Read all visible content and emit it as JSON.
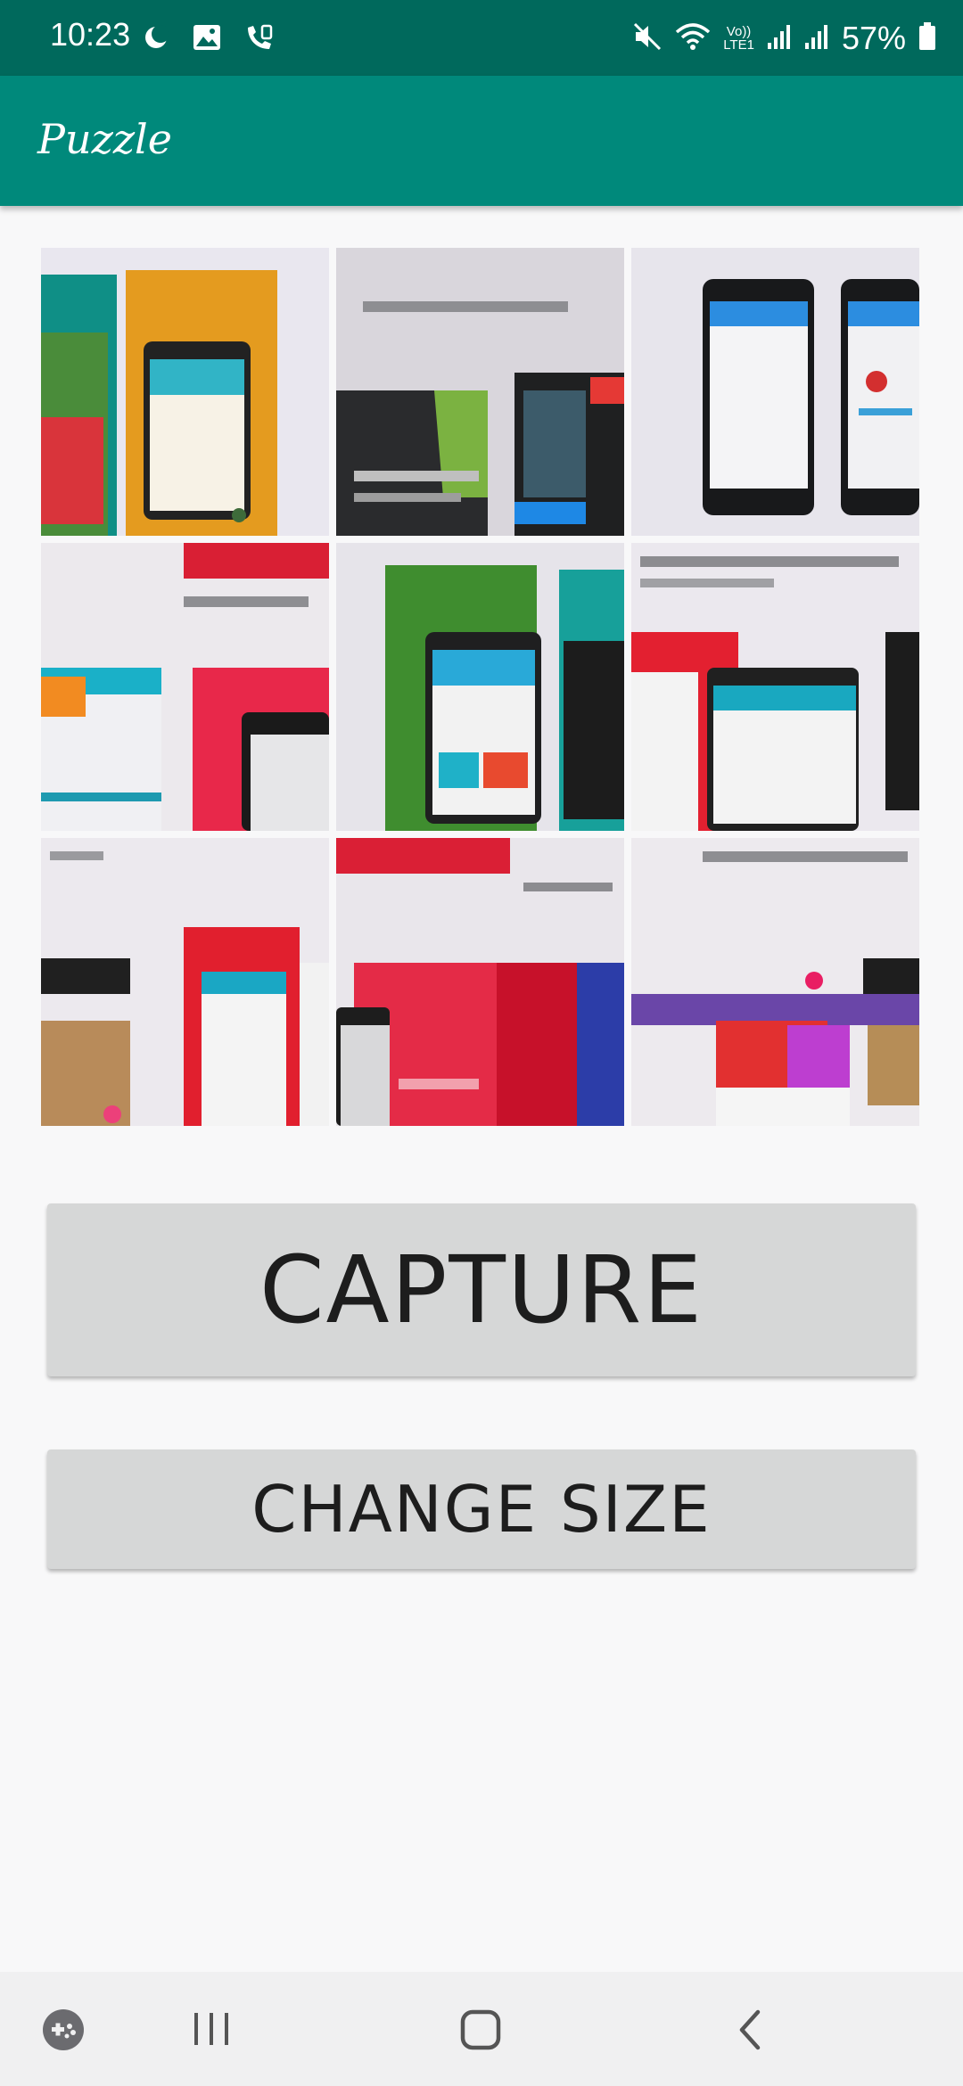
{
  "status_bar": {
    "time": "10:23",
    "volte_label": "Vo))\nLTE1",
    "battery_percent": "57%",
    "left_icons": [
      "moon-icon",
      "gallery-icon",
      "wifi-call-icon"
    ],
    "right_icons": [
      "mute-icon",
      "wifi-icon",
      "signal-icon",
      "signal-icon",
      "battery-icon"
    ]
  },
  "app_bar": {
    "title": "Puzzle"
  },
  "puzzle": {
    "grid_size": "3x3",
    "tiles": [
      {
        "id": "1",
        "theme": "teal-phone-poster"
      },
      {
        "id": "2",
        "theme": "dark-android-slide"
      },
      {
        "id": "3",
        "theme": "two-phones"
      },
      {
        "id": "4",
        "theme": "red-phone-slide"
      },
      {
        "id": "5",
        "theme": "green-phone-poster"
      },
      {
        "id": "6",
        "theme": "red-material-slide"
      },
      {
        "id": "7",
        "theme": "phones-red-panel"
      },
      {
        "id": "8",
        "theme": "pink-red-slide"
      },
      {
        "id": "9",
        "theme": "purple-material-slide"
      }
    ]
  },
  "buttons": {
    "capture": "CAPTURE",
    "change_size": "CHANGE SIZE"
  },
  "nav_bar": {
    "icons": [
      "game-launcher-icon",
      "recent-apps-icon",
      "home-icon",
      "back-icon"
    ]
  },
  "colors": {
    "status_bar": "#00695c",
    "app_bar": "#00897b",
    "button_bg": "#d6d7d7",
    "background": "#f8f8f9"
  }
}
